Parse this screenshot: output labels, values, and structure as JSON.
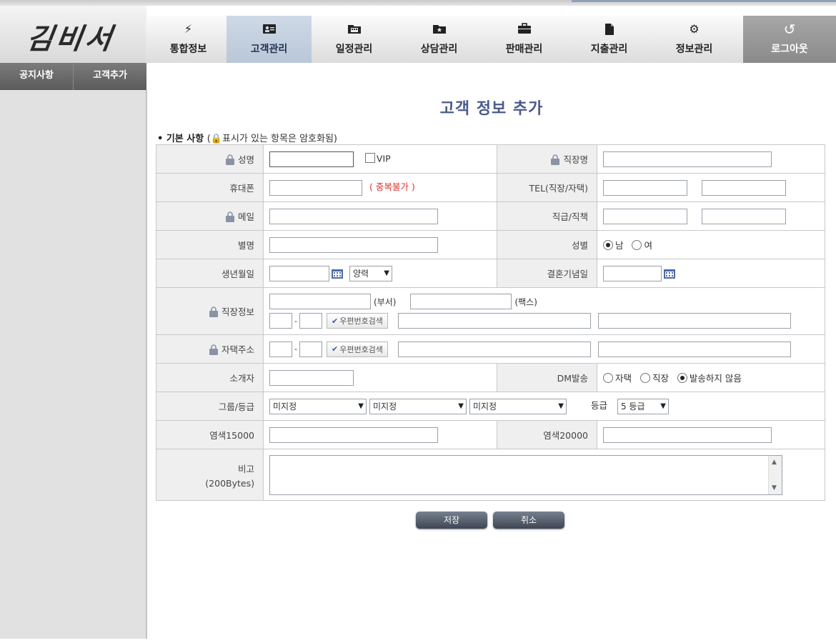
{
  "brand": {
    "logo_text": "김비서"
  },
  "subnav": [
    {
      "label": "공지사항"
    },
    {
      "label": "고객추가"
    }
  ],
  "nav": {
    "tabs": [
      {
        "label": "통합정보",
        "icon": "lightning-icon"
      },
      {
        "label": "고객관리",
        "icon": "contact-card-icon",
        "active": true
      },
      {
        "label": "일정관리",
        "icon": "calendar-folder-icon"
      },
      {
        "label": "상담관리",
        "icon": "star-folder-icon"
      },
      {
        "label": "판매관리",
        "icon": "briefcase-icon"
      },
      {
        "label": "지출관리",
        "icon": "document-icon"
      },
      {
        "label": "정보관리",
        "icon": "gear-icon"
      }
    ],
    "logout": {
      "label": "로그아웃",
      "icon": "logout-arrow-icon"
    }
  },
  "page": {
    "title": "고객 정보 추가",
    "section_label": "• 기본 사항",
    "section_note": "(🔒표시가 있는 항목은 암호화됨)"
  },
  "form": {
    "name_label": "성명",
    "vip_label": "VIP",
    "company_label": "직장명",
    "mobile_label": "휴대폰",
    "duplicate_note": "( 중복불가 )",
    "tel_label": "TEL(직장/자택)",
    "email_label": "메일",
    "position_label": "직급/직책",
    "nickname_label": "별명",
    "gender_label": "성별",
    "gender_male": "남",
    "gender_female": "여",
    "birthday_label": "생년월일",
    "calendar_type": "양력",
    "anniversary_label": "결혼기념일",
    "work_info_label": "직장정보",
    "dept_label": "(부서)",
    "fax_label": "(팩스)",
    "zip_search_label": "우편번호검색",
    "home_address_label": "자택주소",
    "referrer_label": "소개자",
    "dm_label": "DM발송",
    "dm_home": "자택",
    "dm_work": "직장",
    "dm_none": "발송하지 않음",
    "group_label": "그룹/등급",
    "group_option": "미지정",
    "grade_label": "등급",
    "grade_value": "5 등급",
    "custom1_label": "염색15000",
    "custom2_label": "염색20000",
    "note_label": "비고",
    "note_limit": "(200Bytes)",
    "zip_separator": "-"
  },
  "buttons": {
    "save": "저장",
    "cancel": "취소"
  },
  "colors": {
    "title": "#4a5a8a",
    "required_note": "#e0322c",
    "active_tab": "#c3cfdd"
  }
}
